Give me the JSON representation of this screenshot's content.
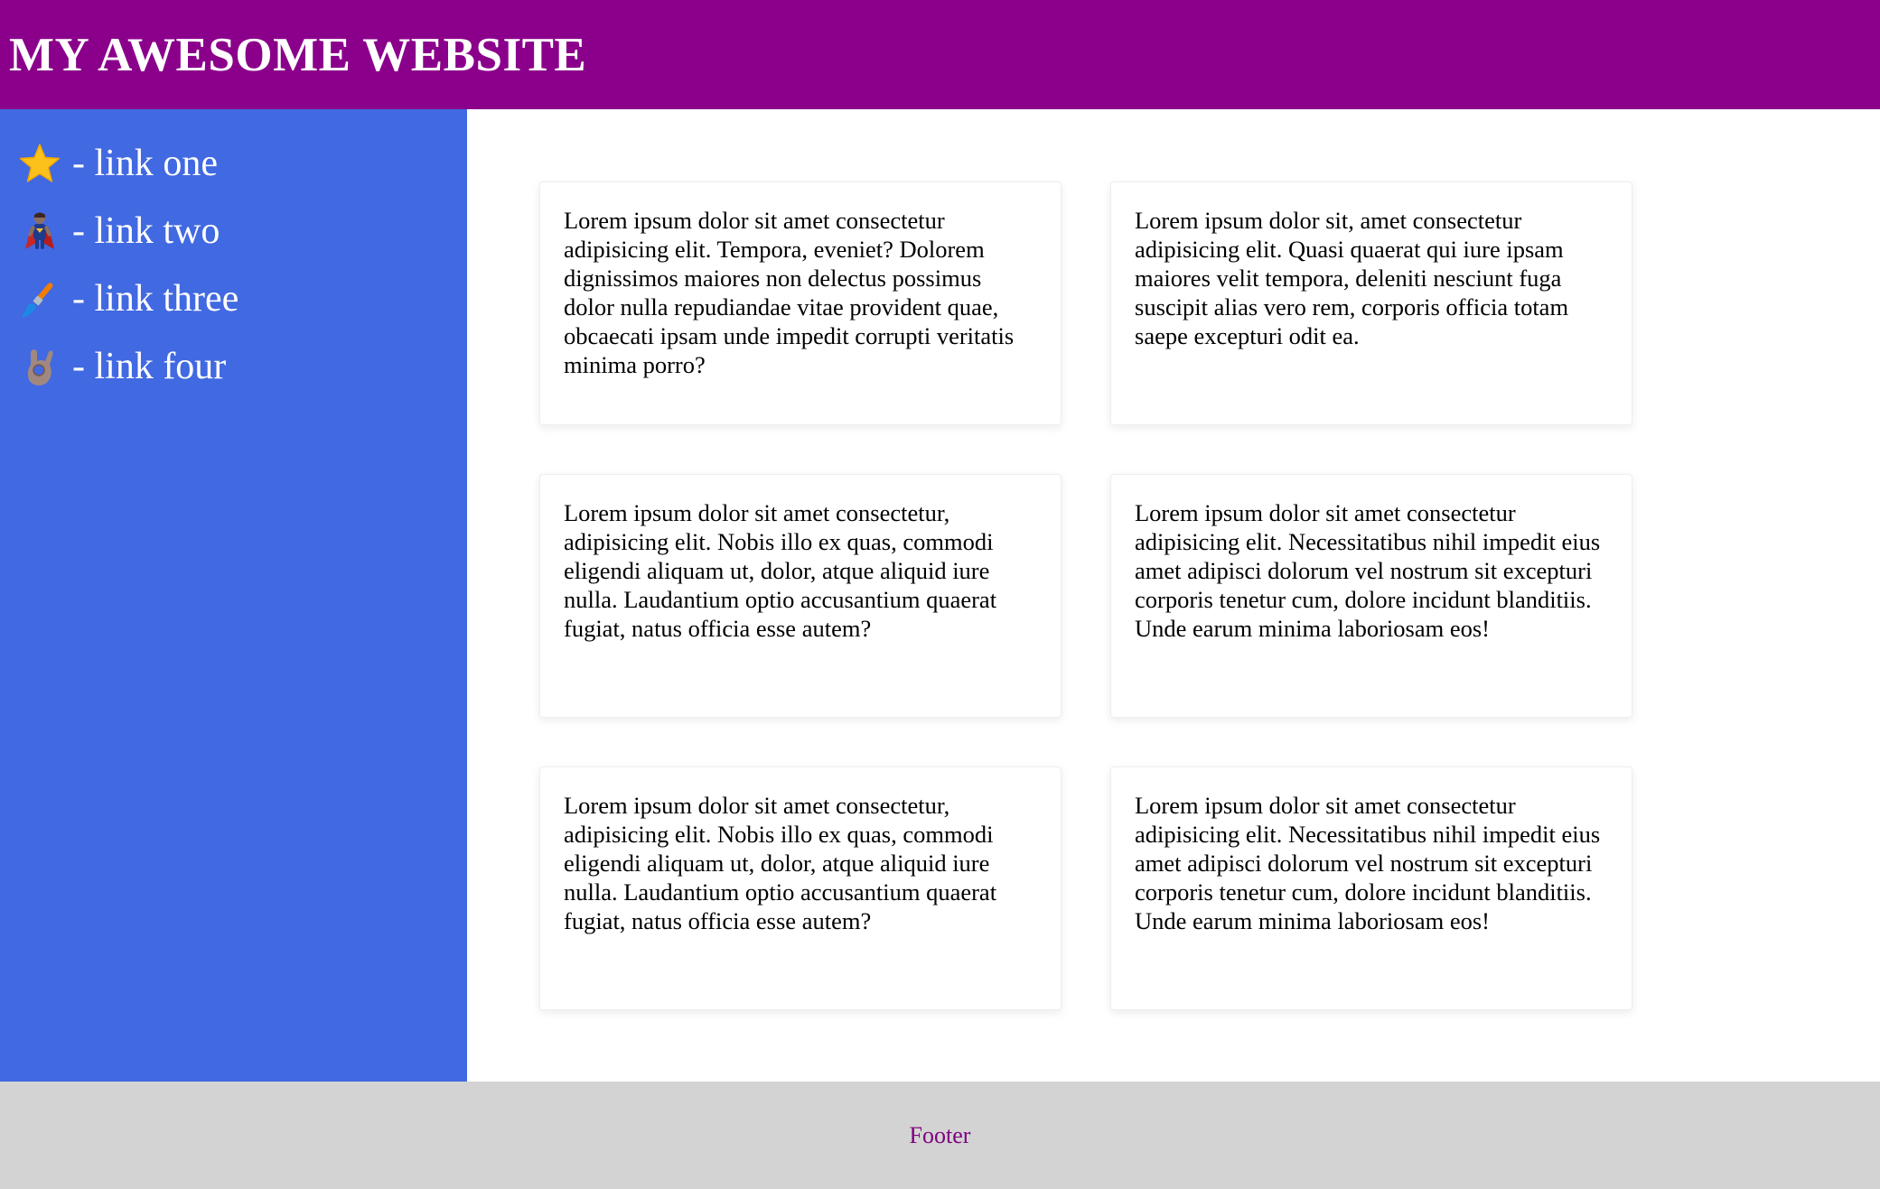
{
  "header": {
    "title": "MY AWESOME WEBSITE"
  },
  "sidebar": {
    "items": [
      {
        "icon": "star-icon",
        "label": "- link one"
      },
      {
        "icon": "superhero-icon",
        "label": "- link two"
      },
      {
        "icon": "paintbrush-icon",
        "label": "- link three"
      },
      {
        "icon": "ok-hand-icon",
        "label": "- link four"
      }
    ]
  },
  "main": {
    "cards": [
      {
        "text": "Lorem ipsum dolor sit amet consectetur adipisicing elit. Tempora, eveniet? Dolorem dignissimos maiores non delectus possimus dolor nulla repudiandae vitae provident quae, obcaecati ipsam unde impedit corrupti veritatis minima porro?"
      },
      {
        "text": "Lorem ipsum dolor sit, amet consectetur adipisicing elit. Quasi quaerat qui iure ipsam maiores velit tempora, deleniti nesciunt fuga suscipit alias vero rem, corporis officia totam saepe excepturi odit ea."
      },
      {
        "text": "Lorem ipsum dolor sit amet consectetur, adipisicing elit. Nobis illo ex quas, commodi eligendi aliquam ut, dolor, atque aliquid iure nulla. Laudantium optio accusantium quaerat fugiat, natus officia esse autem?"
      },
      {
        "text": "Lorem ipsum dolor sit amet consectetur adipisicing elit. Necessitatibus nihil impedit eius amet adipisci dolorum vel nostrum sit excepturi corporis tenetur cum, dolore incidunt blanditiis. Unde earum minima laboriosam eos!"
      },
      {
        "text": "Lorem ipsum dolor sit amet consectetur, adipisicing elit. Nobis illo ex quas, commodi eligendi aliquam ut, dolor, atque aliquid iure nulla. Laudantium optio accusantium quaerat fugiat, natus officia esse autem?"
      },
      {
        "text": "Lorem ipsum dolor sit amet consectetur adipisicing elit. Necessitatibus nihil impedit eius amet adipisci dolorum vel nostrum sit excepturi corporis tenetur cum, dolore incidunt blanditiis. Unde earum minima laboriosam eos!"
      }
    ]
  },
  "footer": {
    "label": "Footer"
  },
  "colors": {
    "header_bg": "#8b008b",
    "sidebar_bg": "#4169e1",
    "footer_bg": "#d3d3d3",
    "footer_text": "#800080"
  }
}
